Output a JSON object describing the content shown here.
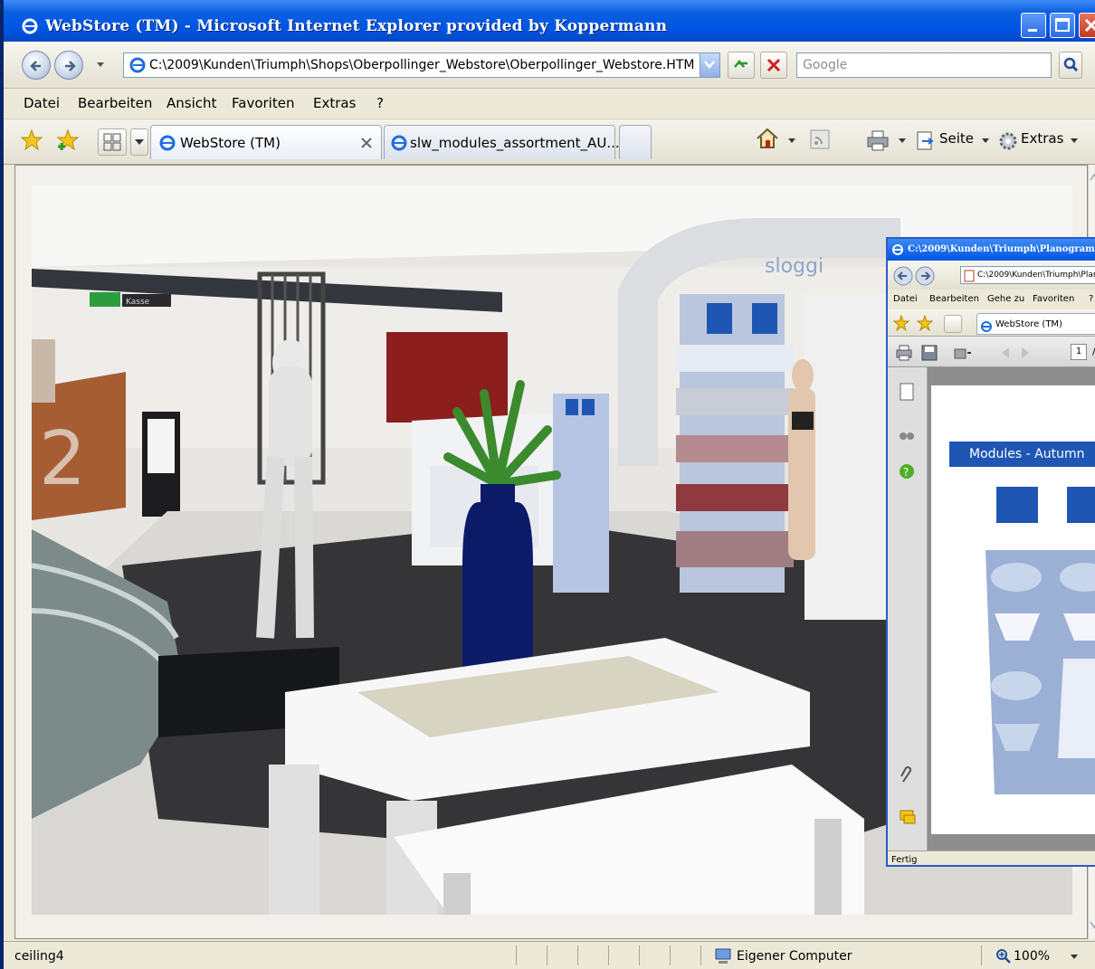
{
  "window": {
    "title": "WebStore (TM) - Microsoft Internet Explorer provided by Koppermann",
    "accent": "#0054E3"
  },
  "navbar": {
    "address": "C:\\2009\\Kunden\\Triumph\\Shops\\Oberpollinger_Webstore\\Oberpollinger_Webstore.HTM",
    "search_placeholder": "Google"
  },
  "menu": {
    "items": [
      "Datei",
      "Bearbeiten",
      "Ansicht",
      "Favoriten",
      "Extras",
      "?"
    ]
  },
  "tabs": [
    {
      "label": "WebStore (TM)",
      "active": true
    },
    {
      "label": "slw_modules_assortment_AU...",
      "active": false
    }
  ],
  "toolbar": {
    "page_label": "Seite",
    "tools_label": "Extras"
  },
  "scene": {
    "sign_exit": "Kasse",
    "floor_number": "2",
    "brand_sign": "sloggi"
  },
  "popup": {
    "title": "C:\\2009\\Kunden\\Triumph\\Planogram",
    "address": "C:\\2009\\Kunden\\Triumph\\Plan",
    "menu": [
      "Datei",
      "Bearbeiten",
      "Gehe zu",
      "Favoriten",
      "?"
    ],
    "tab": "WebStore (TM)",
    "page_number": "1",
    "page_sep": "/",
    "banner": "Modules - Autumn",
    "status": "Fertig"
  },
  "status": {
    "text": "ceiling4",
    "zone": "Eigener Computer",
    "zoom": "100%"
  }
}
